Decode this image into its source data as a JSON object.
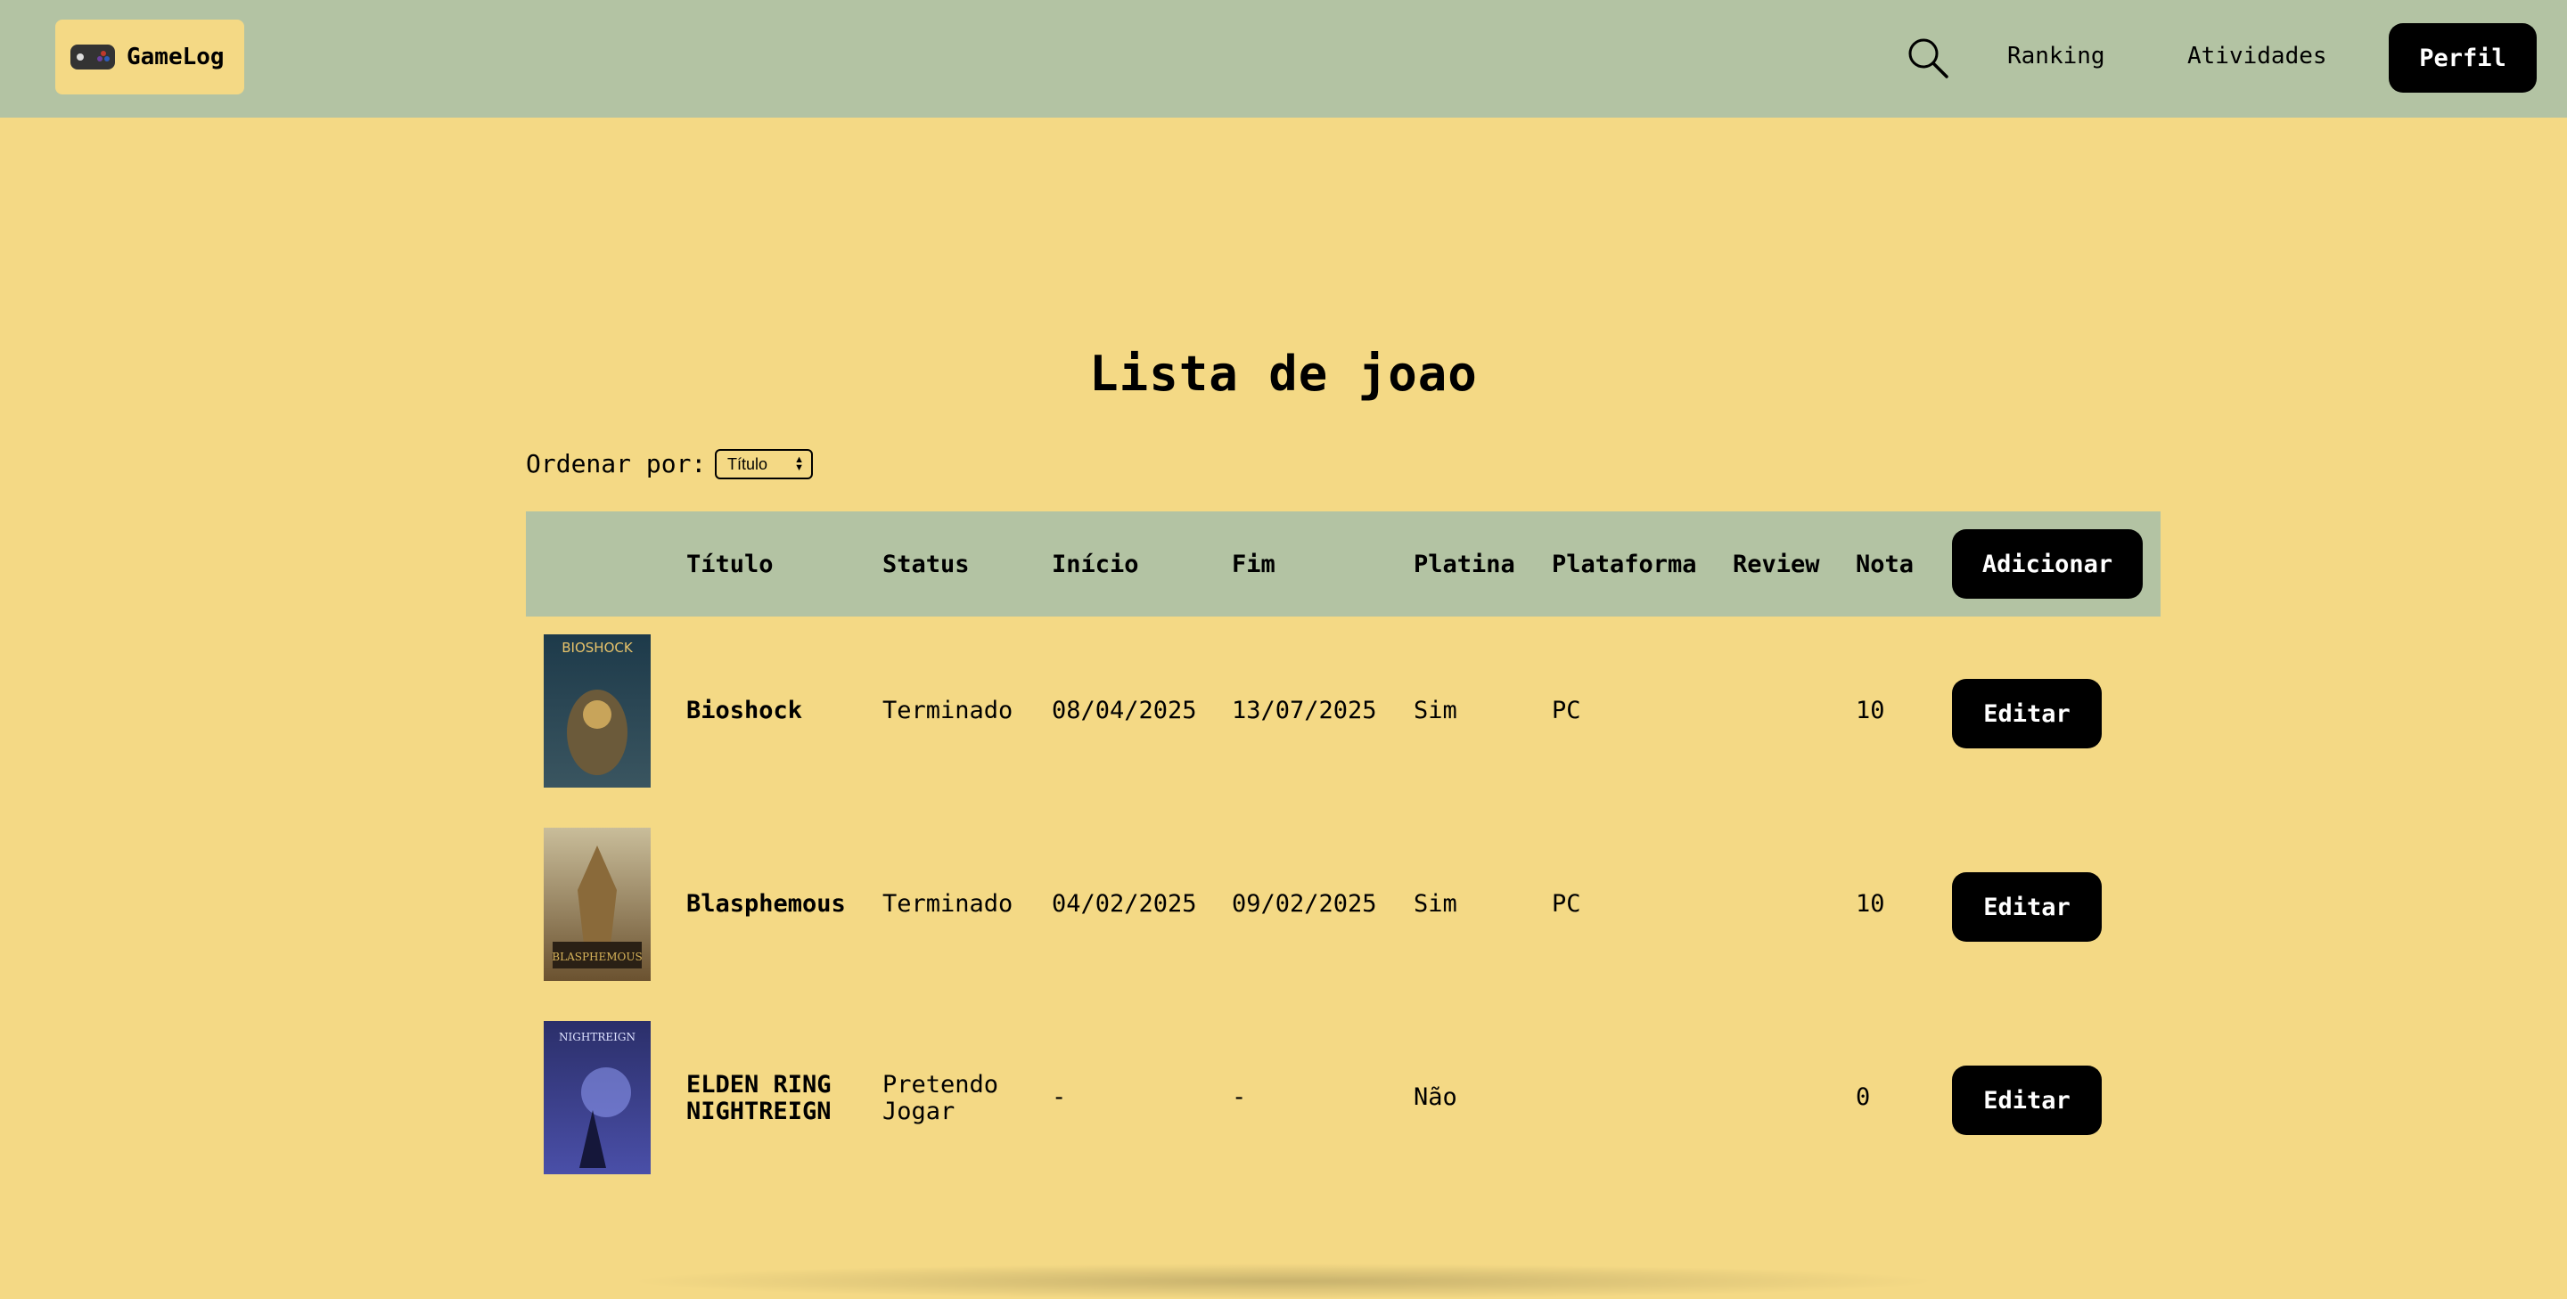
{
  "header": {
    "logo_text": "GameLog",
    "nav": {
      "ranking": "Ranking",
      "atividades": "Atividades"
    },
    "profile_button": "Perfil"
  },
  "page": {
    "title": "Lista de joao",
    "sort_label": "Ordenar por:",
    "sort_value": "Título"
  },
  "table": {
    "headers": {
      "titulo": "Título",
      "status": "Status",
      "inicio": "Início",
      "fim": "Fim",
      "platina": "Platina",
      "plataforma": "Plataforma",
      "review": "Review",
      "nota": "Nota"
    },
    "add_button": "Adicionar",
    "edit_label": "Editar",
    "rows": [
      {
        "title_line1": "Bioshock",
        "title_line2": "",
        "status_line1": "Terminado",
        "status_line2": "",
        "inicio": "08/04/2025",
        "fim": "13/07/2025",
        "platina": "Sim",
        "plataforma": "PC",
        "review": "",
        "nota": "10",
        "cover_text": "BIOSHOCK"
      },
      {
        "title_line1": "Blasphemous",
        "title_line2": "",
        "status_line1": "Terminado",
        "status_line2": "",
        "inicio": "04/02/2025",
        "fim": "09/02/2025",
        "platina": "Sim",
        "plataforma": "PC",
        "review": "",
        "nota": "10",
        "cover_text": "BLASPHEMOUS"
      },
      {
        "title_line1": "ELDEN RING",
        "title_line2": "NIGHTREIGN",
        "status_line1": "Pretendo",
        "status_line2": "Jogar",
        "inicio": "-",
        "fim": "-",
        "platina": "Não",
        "plataforma": "",
        "review": "",
        "nota": "0",
        "cover_text": "NIGHTREIGN"
      }
    ]
  },
  "colors": {
    "background": "#f4d985",
    "header_bg": "#b3c3a3",
    "button_bg": "#000000"
  }
}
